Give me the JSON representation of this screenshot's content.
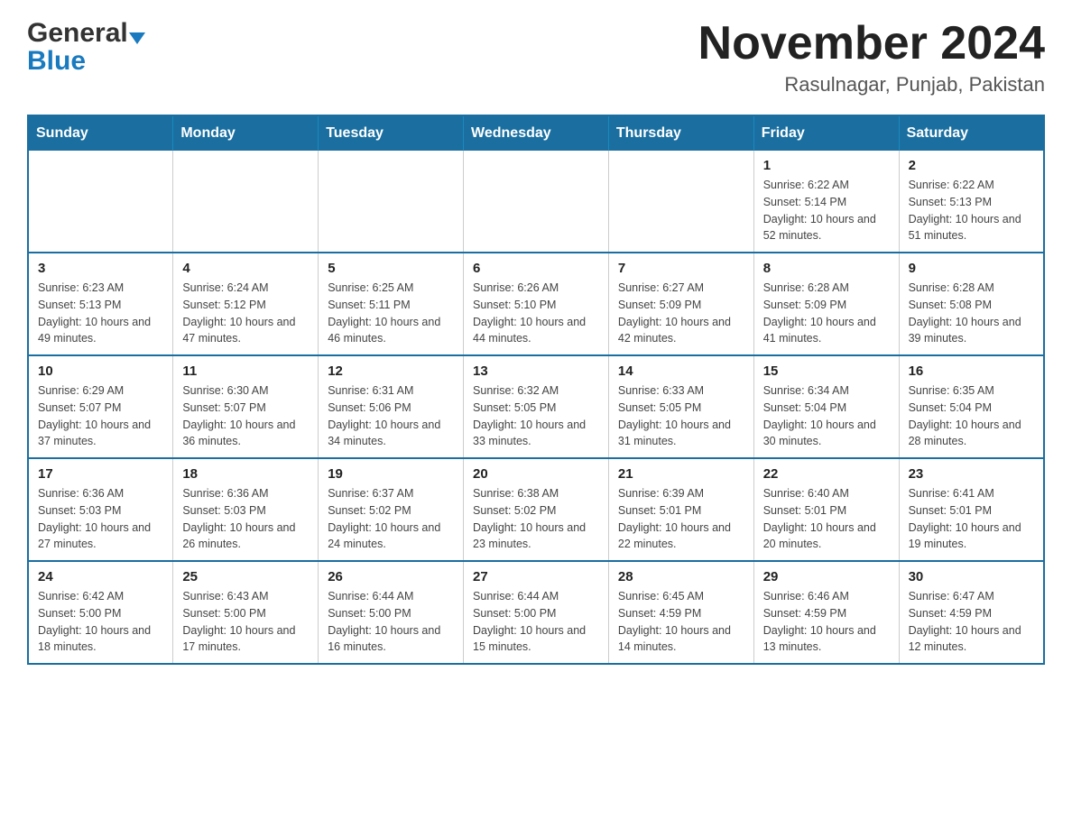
{
  "header": {
    "logo_general": "General",
    "logo_blue": "Blue",
    "month_title": "November 2024",
    "location": "Rasulnagar, Punjab, Pakistan"
  },
  "weekdays": [
    "Sunday",
    "Monday",
    "Tuesday",
    "Wednesday",
    "Thursday",
    "Friday",
    "Saturday"
  ],
  "weeks": [
    [
      {
        "day": "",
        "info": ""
      },
      {
        "day": "",
        "info": ""
      },
      {
        "day": "",
        "info": ""
      },
      {
        "day": "",
        "info": ""
      },
      {
        "day": "",
        "info": ""
      },
      {
        "day": "1",
        "info": "Sunrise: 6:22 AM\nSunset: 5:14 PM\nDaylight: 10 hours and 52 minutes."
      },
      {
        "day": "2",
        "info": "Sunrise: 6:22 AM\nSunset: 5:13 PM\nDaylight: 10 hours and 51 minutes."
      }
    ],
    [
      {
        "day": "3",
        "info": "Sunrise: 6:23 AM\nSunset: 5:13 PM\nDaylight: 10 hours and 49 minutes."
      },
      {
        "day": "4",
        "info": "Sunrise: 6:24 AM\nSunset: 5:12 PM\nDaylight: 10 hours and 47 minutes."
      },
      {
        "day": "5",
        "info": "Sunrise: 6:25 AM\nSunset: 5:11 PM\nDaylight: 10 hours and 46 minutes."
      },
      {
        "day": "6",
        "info": "Sunrise: 6:26 AM\nSunset: 5:10 PM\nDaylight: 10 hours and 44 minutes."
      },
      {
        "day": "7",
        "info": "Sunrise: 6:27 AM\nSunset: 5:09 PM\nDaylight: 10 hours and 42 minutes."
      },
      {
        "day": "8",
        "info": "Sunrise: 6:28 AM\nSunset: 5:09 PM\nDaylight: 10 hours and 41 minutes."
      },
      {
        "day": "9",
        "info": "Sunrise: 6:28 AM\nSunset: 5:08 PM\nDaylight: 10 hours and 39 minutes."
      }
    ],
    [
      {
        "day": "10",
        "info": "Sunrise: 6:29 AM\nSunset: 5:07 PM\nDaylight: 10 hours and 37 minutes."
      },
      {
        "day": "11",
        "info": "Sunrise: 6:30 AM\nSunset: 5:07 PM\nDaylight: 10 hours and 36 minutes."
      },
      {
        "day": "12",
        "info": "Sunrise: 6:31 AM\nSunset: 5:06 PM\nDaylight: 10 hours and 34 minutes."
      },
      {
        "day": "13",
        "info": "Sunrise: 6:32 AM\nSunset: 5:05 PM\nDaylight: 10 hours and 33 minutes."
      },
      {
        "day": "14",
        "info": "Sunrise: 6:33 AM\nSunset: 5:05 PM\nDaylight: 10 hours and 31 minutes."
      },
      {
        "day": "15",
        "info": "Sunrise: 6:34 AM\nSunset: 5:04 PM\nDaylight: 10 hours and 30 minutes."
      },
      {
        "day": "16",
        "info": "Sunrise: 6:35 AM\nSunset: 5:04 PM\nDaylight: 10 hours and 28 minutes."
      }
    ],
    [
      {
        "day": "17",
        "info": "Sunrise: 6:36 AM\nSunset: 5:03 PM\nDaylight: 10 hours and 27 minutes."
      },
      {
        "day": "18",
        "info": "Sunrise: 6:36 AM\nSunset: 5:03 PM\nDaylight: 10 hours and 26 minutes."
      },
      {
        "day": "19",
        "info": "Sunrise: 6:37 AM\nSunset: 5:02 PM\nDaylight: 10 hours and 24 minutes."
      },
      {
        "day": "20",
        "info": "Sunrise: 6:38 AM\nSunset: 5:02 PM\nDaylight: 10 hours and 23 minutes."
      },
      {
        "day": "21",
        "info": "Sunrise: 6:39 AM\nSunset: 5:01 PM\nDaylight: 10 hours and 22 minutes."
      },
      {
        "day": "22",
        "info": "Sunrise: 6:40 AM\nSunset: 5:01 PM\nDaylight: 10 hours and 20 minutes."
      },
      {
        "day": "23",
        "info": "Sunrise: 6:41 AM\nSunset: 5:01 PM\nDaylight: 10 hours and 19 minutes."
      }
    ],
    [
      {
        "day": "24",
        "info": "Sunrise: 6:42 AM\nSunset: 5:00 PM\nDaylight: 10 hours and 18 minutes."
      },
      {
        "day": "25",
        "info": "Sunrise: 6:43 AM\nSunset: 5:00 PM\nDaylight: 10 hours and 17 minutes."
      },
      {
        "day": "26",
        "info": "Sunrise: 6:44 AM\nSunset: 5:00 PM\nDaylight: 10 hours and 16 minutes."
      },
      {
        "day": "27",
        "info": "Sunrise: 6:44 AM\nSunset: 5:00 PM\nDaylight: 10 hours and 15 minutes."
      },
      {
        "day": "28",
        "info": "Sunrise: 6:45 AM\nSunset: 4:59 PM\nDaylight: 10 hours and 14 minutes."
      },
      {
        "day": "29",
        "info": "Sunrise: 6:46 AM\nSunset: 4:59 PM\nDaylight: 10 hours and 13 minutes."
      },
      {
        "day": "30",
        "info": "Sunrise: 6:47 AM\nSunset: 4:59 PM\nDaylight: 10 hours and 12 minutes."
      }
    ]
  ]
}
